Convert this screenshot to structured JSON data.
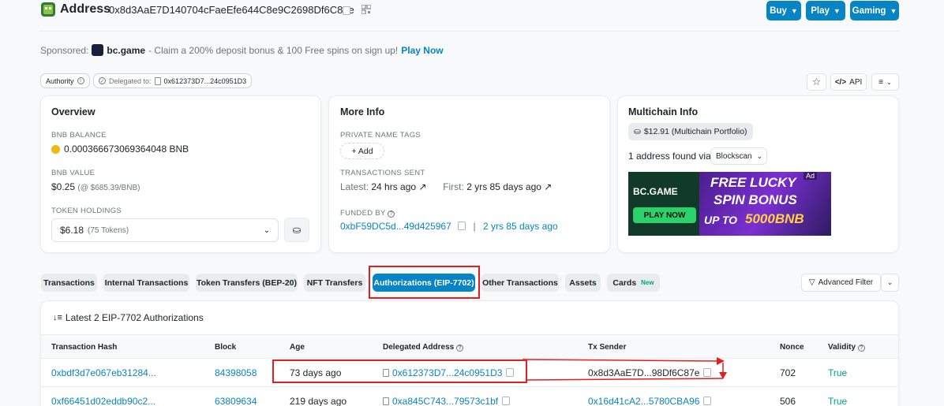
{
  "header": {
    "title": "Address",
    "address": "0x8d3AaE7D140704cFaeEfe644C8e9C2698Df6C87e",
    "buttons": [
      "Buy",
      "Play",
      "Gaming"
    ]
  },
  "sponsor": {
    "prefix": "Sponsored:",
    "name": "bc.game",
    "text": "- Claim a 200% deposit bonus & 100 Free spins on sign up!",
    "cta": "Play Now"
  },
  "tags": {
    "authority": "Authority",
    "delegated_prefix": "Delegated to:",
    "delegated_addr": "0x612373D7...24c0951D3"
  },
  "toolbar": {
    "api": "API"
  },
  "overview": {
    "title": "Overview",
    "balance_label": "BNB BALANCE",
    "balance": "0.000366673069364048 BNB",
    "value_label": "BNB VALUE",
    "value": "$0.25",
    "value_rate": "(@ $685.39/BNB)",
    "holdings_label": "TOKEN HOLDINGS",
    "holdings_value": "$6.18",
    "holdings_count": "(75 Tokens)"
  },
  "more_info": {
    "title": "More Info",
    "name_tags_label": "PRIVATE NAME TAGS",
    "add_label": "+ Add",
    "tx_sent_label": "TRANSACTIONS SENT",
    "latest_label": "Latest:",
    "latest_value": "24 hrs ago",
    "first_label": "First:",
    "first_value": "2 yrs 85 days ago",
    "funded_label": "FUNDED BY",
    "funded_addr": "0xbF59DC5d...49d425967",
    "funded_time": "2 yrs 85 days ago"
  },
  "multichain": {
    "title": "Multichain Info",
    "portfolio": "$12.91 (Multichain Portfolio)",
    "found_text": "1 address found via",
    "explorer": "Blockscan",
    "ad_label": "Ad",
    "ad_brand": "BC.GAME",
    "ad_cta": "PLAY NOW",
    "ad_line1": "FREE LUCKY",
    "ad_line2": "SPIN BONUS",
    "ad_line3": "UP TO",
    "ad_line4": "5000BNB"
  },
  "tabs": [
    {
      "label": "Transactions",
      "active": false
    },
    {
      "label": "Internal Transactions",
      "active": false
    },
    {
      "label": "Token Transfers (BEP-20)",
      "active": false
    },
    {
      "label": "NFT Transfers",
      "active": false
    },
    {
      "label": "Authorizations (EIP-7702)",
      "active": true
    },
    {
      "label": "Other Transactions",
      "active": false
    },
    {
      "label": "Assets",
      "active": false
    },
    {
      "label": "Cards",
      "active": false,
      "badge": "New"
    }
  ],
  "advanced_filter": "Advanced Filter",
  "table": {
    "summary": "Latest 2 EIP-7702 Authorizations",
    "columns": [
      "Transaction Hash",
      "Block",
      "Age",
      "Delegated Address",
      "Tx Sender",
      "Nonce",
      "Validity"
    ],
    "rows": [
      {
        "hash": "0xbdf3d7e067eb31284...",
        "block": "84398058",
        "age": "73 days ago",
        "delegated": "0x612373D7...24c0951D3",
        "sender": "0x8d3AaE7D...98Df6C87e",
        "nonce": "702",
        "validity": "True"
      },
      {
        "hash": "0xf66451d02eddb90c2...",
        "block": "63809634",
        "age": "219 days ago",
        "delegated": "0xa845C743...79573c1bf",
        "sender": "0x16d41cA2...5780CBA96",
        "nonce": "506",
        "validity": "True"
      }
    ]
  },
  "colors": {
    "accent": "#0784c3",
    "annotation": "#e02020",
    "valid": "#00a186"
  }
}
